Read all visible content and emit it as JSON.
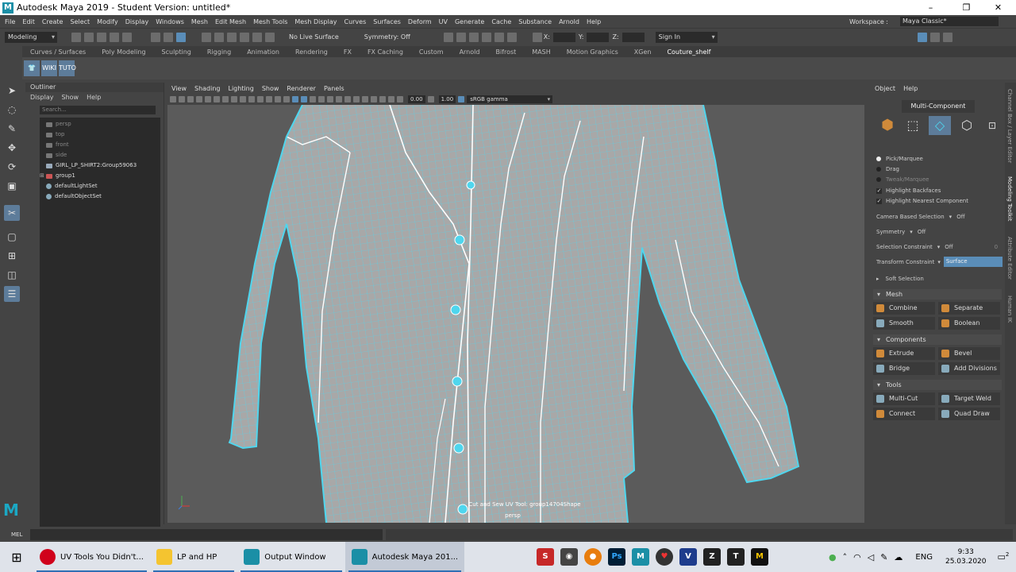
{
  "window": {
    "title": "Autodesk Maya 2019 - Student Version: untitled*",
    "logo": "M",
    "controls": [
      "–",
      "❐",
      "✕"
    ]
  },
  "menubar": {
    "items": [
      "File",
      "Edit",
      "Create",
      "Select",
      "Modify",
      "Display",
      "Windows",
      "Mesh",
      "Edit Mesh",
      "Mesh Tools",
      "Mesh Display",
      "Curves",
      "Surfaces",
      "Deform",
      "UV",
      "Generate",
      "Cache",
      "Substance",
      "Arnold",
      "Help"
    ],
    "workspace_label": "Workspace :",
    "workspace_value": "Maya Classic*"
  },
  "statusline": {
    "mode": "Modeling",
    "live_surface": "No Live Surface",
    "symmetry": "Symmetry: Off",
    "x_label": "X:",
    "y_label": "Y:",
    "z_label": "Z:",
    "sign_in": "Sign In"
  },
  "shelf": {
    "tabs": [
      "Curves / Surfaces",
      "Poly Modeling",
      "Sculpting",
      "Rigging",
      "Animation",
      "Rendering",
      "FX",
      "FX Caching",
      "Custom",
      "Arnold",
      "Bifrost",
      "MASH",
      "Motion Graphics",
      "XGen",
      "Couture_shelf"
    ],
    "active_tab": "Couture_shelf",
    "buttons": [
      "WIKI",
      "TUTO"
    ]
  },
  "outliner": {
    "title": "Outliner",
    "menu": [
      "Display",
      "Show",
      "Help"
    ],
    "search_placeholder": "Search...",
    "items": [
      {
        "label": "persp",
        "dim": true
      },
      {
        "label": "top",
        "dim": true
      },
      {
        "label": "front",
        "dim": true
      },
      {
        "label": "side",
        "dim": true
      },
      {
        "label": "GIRL_LP_SHIRT2:Group59063",
        "dim": false
      },
      {
        "label": "group1",
        "dim": false
      },
      {
        "label": "defaultLightSet",
        "dim": false
      },
      {
        "label": "defaultObjectSet",
        "dim": false
      }
    ]
  },
  "viewport": {
    "menu": [
      "View",
      "Shading",
      "Lighting",
      "Show",
      "Renderer",
      "Panels"
    ],
    "near_value": "0.00",
    "far_value": "1.00",
    "color_space": "sRGB gamma",
    "hud_label": "Cut and Sew UV Tool: group14704Shape",
    "camera_label": "persp"
  },
  "modeling_toolkit": {
    "menu": [
      "Object",
      "Help"
    ],
    "mode": "Multi-Component",
    "pick_options": [
      {
        "label": "Pick/Marquee",
        "on": true
      },
      {
        "label": "Drag",
        "on": false
      },
      {
        "label": "Tweak/Marquee",
        "on": false
      }
    ],
    "checks": [
      "Highlight Backfaces",
      "Highlight Nearest Component"
    ],
    "camera_based_selection": {
      "label": "Camera Based Selection",
      "value": "Off"
    },
    "symmetry": {
      "label": "Symmetry",
      "value": "Off"
    },
    "selection_constraint": {
      "label": "Selection Constraint",
      "value": "Off",
      "num": "0"
    },
    "transform_constraint": {
      "label": "Transform Constraint",
      "value": "Surface"
    },
    "soft_selection": "Soft Selection",
    "sections": {
      "mesh": {
        "title": "Mesh",
        "buttons": [
          "Combine",
          "Separate",
          "Smooth",
          "Boolean"
        ]
      },
      "components": {
        "title": "Components",
        "buttons": [
          "Extrude",
          "Bevel",
          "Bridge",
          "Add Divisions"
        ]
      },
      "tools": {
        "title": "Tools",
        "buttons": [
          "Multi-Cut",
          "Target Weld",
          "Connect",
          "Quad Draw"
        ]
      }
    }
  },
  "side_tabs": [
    "Channel Box / Layer Editor",
    "Modeling Toolkit",
    "Attribute Editor",
    "Human IK"
  ],
  "command_line": {
    "label": "MEL"
  },
  "taskbar": {
    "apps": [
      {
        "label": "UV Tools You Didn't...",
        "color": "#d0021b"
      },
      {
        "label": "LP and HP",
        "color": "#f4c430"
      },
      {
        "label": "Output Window",
        "color": "#1b8fa6"
      },
      {
        "label": "Autodesk Maya 201...",
        "color": "#1b8fa6"
      }
    ],
    "language": "ENG",
    "time": "9:33",
    "date": "25.03.2020",
    "notifications": "2"
  },
  "colors": {
    "wire": "#4fd6ee",
    "accent": "#5d7c9a",
    "orange_icon": "#d08a3a"
  }
}
